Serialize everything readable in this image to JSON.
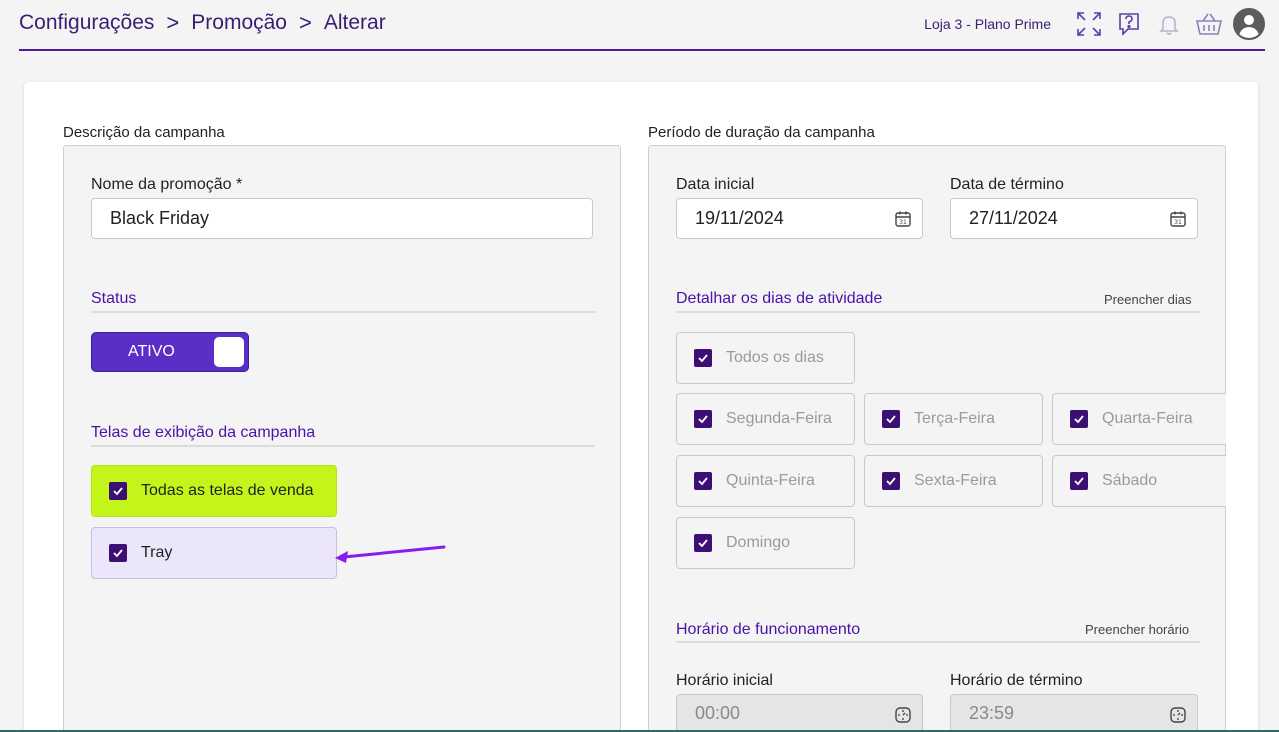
{
  "header": {
    "breadcrumb": [
      "Configurações",
      "Promoção",
      "Alterar"
    ],
    "separator": ">",
    "store": "Loja 3 - Plano Prime",
    "icons": [
      "fullscreen-icon",
      "help-icon",
      "bell-icon",
      "basket-icon",
      "avatar-icon"
    ]
  },
  "campaign": {
    "section_title": "Descrição da campanha",
    "name_label": "Nome da promoção *",
    "name_value": "Black Friday",
    "status_title": "Status",
    "status_value": "ATIVO",
    "screens_title": "Telas de exibição da campanha",
    "screens": [
      {
        "label": "Todas as telas de venda",
        "checked": true
      },
      {
        "label": "Tray",
        "checked": true
      }
    ]
  },
  "period": {
    "section_title": "Período de duração da campanha",
    "start_label": "Data inicial",
    "start_value": "19/11/2024",
    "end_label": "Data de término",
    "end_value": "27/11/2024",
    "days_title": "Detalhar os dias de atividade",
    "days_fill_link": "Preencher dias",
    "all_days": "Todos os dias",
    "days": [
      "Segunda-Feira",
      "Terça-Feira",
      "Quarta-Feira",
      "Quinta-Feira",
      "Sexta-Feira",
      "Sábado",
      "Domingo"
    ],
    "hours_title": "Horário de funcionamento",
    "hours_fill_link": "Preencher horário",
    "start_time_label": "Horário inicial",
    "start_time_value": "00:00",
    "end_time_label": "Horário de término",
    "end_time_value": "23:59"
  },
  "colors": {
    "accent": "#4a12a8",
    "toggle": "#5a2fc7",
    "checkbox": "#3b0f73",
    "highlight_tile": "#c4f51b",
    "selected_tile": "#ebe6fa",
    "arrow": "#8a1cf0"
  }
}
